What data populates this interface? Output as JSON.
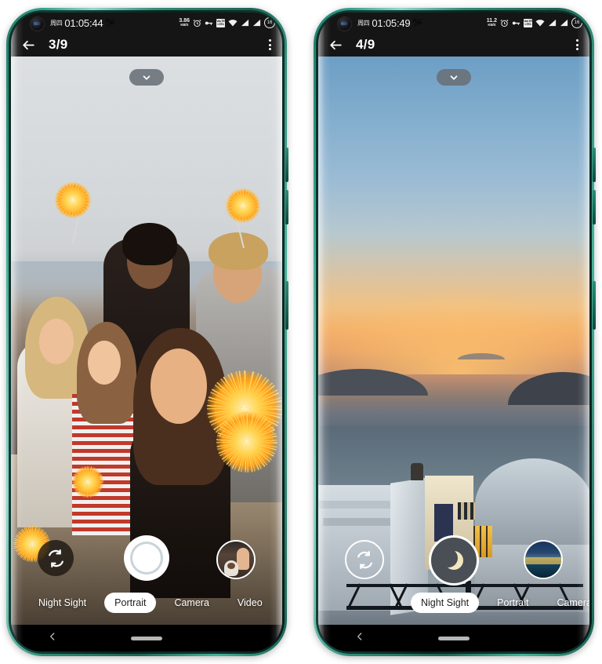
{
  "phones": [
    {
      "id": "left",
      "status_bar": {
        "day": "周四",
        "time": "01:05:44",
        "emoji": "🛩",
        "net_speed_value": "3.86",
        "net_speed_unit": "KB/S",
        "alarm_icon": "alarm-clock-icon",
        "key_icon": "vpn-key-icon",
        "volte_line1": "VoLTE",
        "volte_line2": "LTE1",
        "wifi_icon": "wifi-icon",
        "signal_icon": "signal-bars-icon",
        "battery_level": "16"
      },
      "app_bar": {
        "back_icon": "back-arrow-icon",
        "page_count": "3/9",
        "menu_icon": "overflow-menu-icon"
      },
      "camera": {
        "expand_icon": "chevron-down-icon",
        "flip_icon": "switch-camera-icon",
        "shutter_type": "plain",
        "shutter_icon": "shutter-button",
        "thumbnail_name": "last-photo-thumbnail-selfie-with-dog",
        "modes": [
          {
            "label": "Night Sight",
            "active": false
          },
          {
            "label": "Portrait",
            "active": true
          },
          {
            "label": "Camera",
            "active": false
          },
          {
            "label": "Video",
            "active": false
          }
        ],
        "scene": "group-selfie-with-sparklers-on-beach"
      },
      "nav_bar": {
        "back_icon": "nav-back-icon",
        "home_icon": "nav-home-pill"
      }
    },
    {
      "id": "right",
      "status_bar": {
        "day": "周四",
        "time": "01:05:49",
        "emoji": "🛩",
        "net_speed_value": "11.2",
        "net_speed_unit": "KB/S",
        "alarm_icon": "alarm-clock-icon",
        "key_icon": "vpn-key-icon",
        "volte_line1": "VoLTE",
        "volte_line2": "LTE1",
        "wifi_icon": "wifi-icon",
        "signal_icon": "signal-bars-icon",
        "battery_level": "16"
      },
      "app_bar": {
        "back_icon": "back-arrow-icon",
        "page_count": "4/9",
        "menu_icon": "overflow-menu-icon"
      },
      "camera": {
        "expand_icon": "chevron-down-icon",
        "flip_icon": "switch-camera-icon",
        "shutter_type": "moon",
        "shutter_icon": "night-sight-moon-icon",
        "thumbnail_name": "last-photo-thumbnail-night-cityscape",
        "modes": [
          {
            "label": "Night Sight",
            "active": true
          },
          {
            "label": "Portrait",
            "active": false
          },
          {
            "label": "Camera",
            "active": false
          }
        ],
        "scene": "santorini-sunset-over-caldera"
      },
      "nav_bar": {
        "back_icon": "nav-back-icon",
        "home_icon": "nav-home-pill"
      }
    }
  ],
  "colors": {
    "frame_teal": "#2e8d77",
    "frame_teal_light": "#8fd9c9",
    "status_bg": "#151515",
    "active_pill": "#ffffff",
    "shutter_night_bg": "#4a4f56",
    "moon": "#f2e6c0"
  }
}
